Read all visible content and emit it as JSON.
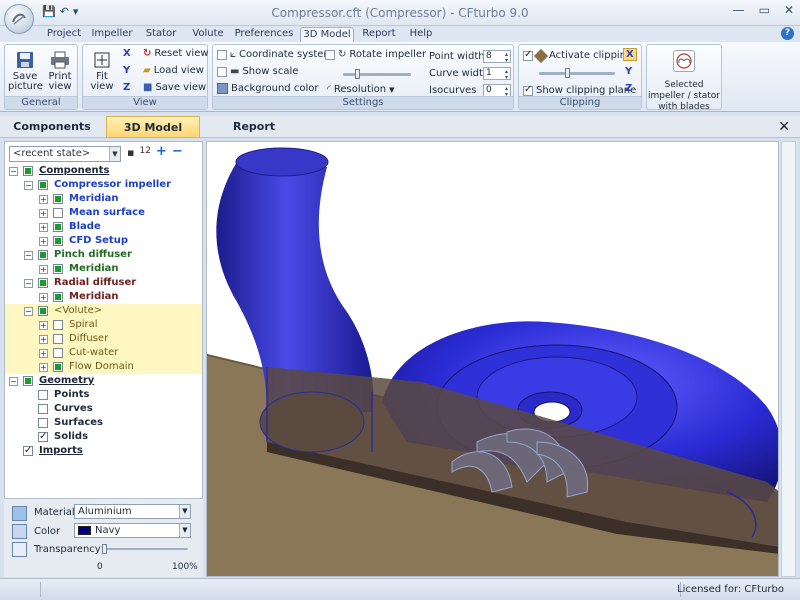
{
  "window": {
    "title": "Compressor.cft (Compressor) - CFturbo 9.0"
  },
  "ribbon_tabs": [
    "Project",
    "Impeller",
    "Stator",
    "Volute",
    "Preferences",
    "3D Model",
    "Report",
    "Help"
  ],
  "active_ribbon_tab": "3D Model",
  "ribbon": {
    "general": {
      "label": "General",
      "save_picture": "Save picture",
      "print_view": "Print view"
    },
    "view": {
      "label": "View",
      "fit_view": "Fit view",
      "reset_view": "Reset view",
      "load_view": "Load view",
      "save_view": "Save view",
      "axis_x": "X",
      "axis_y": "Y",
      "axis_z": "Z"
    },
    "settings": {
      "label": "Settings",
      "coordinate_system": "Coordinate system",
      "show_scale": "Show scale",
      "background_color": "Background color",
      "rotate_impeller": "Rotate impeller",
      "resolution": "Resolution",
      "point_width_label": "Point width",
      "point_width": "8",
      "curve_width_label": "Curve width",
      "curve_width": "1",
      "isocurves_label": "Isocurves",
      "isocurves": "0"
    },
    "clipping": {
      "label": "Clipping",
      "activate_clipping": "Activate clipping",
      "show_clipping_plane": "Show clipping plane",
      "axis_x": "X",
      "axis_y": "Y",
      "axis_z": "Z"
    },
    "selected": {
      "label": "Selected impeller / stator with blades"
    }
  },
  "main_tabs": [
    "Components",
    "3D Model",
    "Report"
  ],
  "active_main_tab": "3D Model",
  "left_panel": {
    "state_select": "<recent state>",
    "tree": [
      {
        "label": "Components",
        "style": "c-dark",
        "depth": 0,
        "check": "fill",
        "expander": "-"
      },
      {
        "label": "Compressor impeller",
        "style": "c-blue",
        "depth": 1,
        "check": "fill",
        "expander": "-"
      },
      {
        "label": "Meridian",
        "style": "c-blue",
        "depth": 2,
        "check": "fill",
        "expander": "+"
      },
      {
        "label": "Mean surface",
        "style": "c-blue",
        "depth": 2,
        "check": "none",
        "expander": "+"
      },
      {
        "label": "Blade",
        "style": "c-blue",
        "depth": 2,
        "check": "fill",
        "expander": "+"
      },
      {
        "label": "CFD Setup",
        "style": "c-blue",
        "depth": 2,
        "check": "fill",
        "expander": "+"
      },
      {
        "label": "Pinch diffuser",
        "style": "c-green",
        "depth": 1,
        "check": "fill",
        "expander": "-"
      },
      {
        "label": "Meridian",
        "style": "c-green",
        "depth": 2,
        "check": "fill",
        "expander": "+"
      },
      {
        "label": "Radial diffuser",
        "style": "c-maroon",
        "depth": 1,
        "check": "fill",
        "expander": "-"
      },
      {
        "label": "Meridian",
        "style": "c-maroon",
        "depth": 2,
        "check": "fill",
        "expander": "+"
      },
      {
        "label": "<Volute>",
        "style": "c-olive",
        "depth": 1,
        "check": "fill",
        "expander": "-",
        "highlight": true
      },
      {
        "label": "Spiral",
        "style": "c-olive",
        "depth": 2,
        "check": "none",
        "expander": "+",
        "highlight": true
      },
      {
        "label": "Diffuser",
        "style": "c-olive",
        "depth": 2,
        "check": "none",
        "expander": "+",
        "highlight": true
      },
      {
        "label": "Cut-water",
        "style": "c-olive",
        "depth": 2,
        "check": "none",
        "expander": "+",
        "highlight": true
      },
      {
        "label": "Flow Domain",
        "style": "c-olive",
        "depth": 2,
        "check": "fill",
        "expander": "+",
        "highlight": true
      },
      {
        "label": "Geometry",
        "style": "c-dark",
        "depth": 0,
        "check": "fill",
        "expander": "-"
      },
      {
        "label": "Points",
        "style": "c-black",
        "depth": 1,
        "check": "none",
        "expander": ""
      },
      {
        "label": "Curves",
        "style": "c-black",
        "depth": 1,
        "check": "none",
        "expander": ""
      },
      {
        "label": "Surfaces",
        "style": "c-black",
        "depth": 1,
        "check": "none",
        "expander": ""
      },
      {
        "label": "Solids",
        "style": "c-black",
        "depth": 1,
        "check": "tick",
        "expander": ""
      },
      {
        "label": "Imports",
        "style": "c-dark",
        "depth": 0,
        "check": "tick",
        "expander": ""
      }
    ],
    "properties": {
      "material_label": "Material",
      "material": "Aluminium",
      "color_label": "Color",
      "color": "Navy",
      "color_hex": "#000080",
      "transparency_label": "Transparency",
      "transparency_min": "0",
      "transparency_max": "100%",
      "transparency_value": 0
    }
  },
  "colors": {
    "volute": "#2424c8",
    "housing": "#5b4a3f",
    "floor": "#8a7757"
  },
  "status": {
    "license": "Licensed for:  CFturbo"
  }
}
